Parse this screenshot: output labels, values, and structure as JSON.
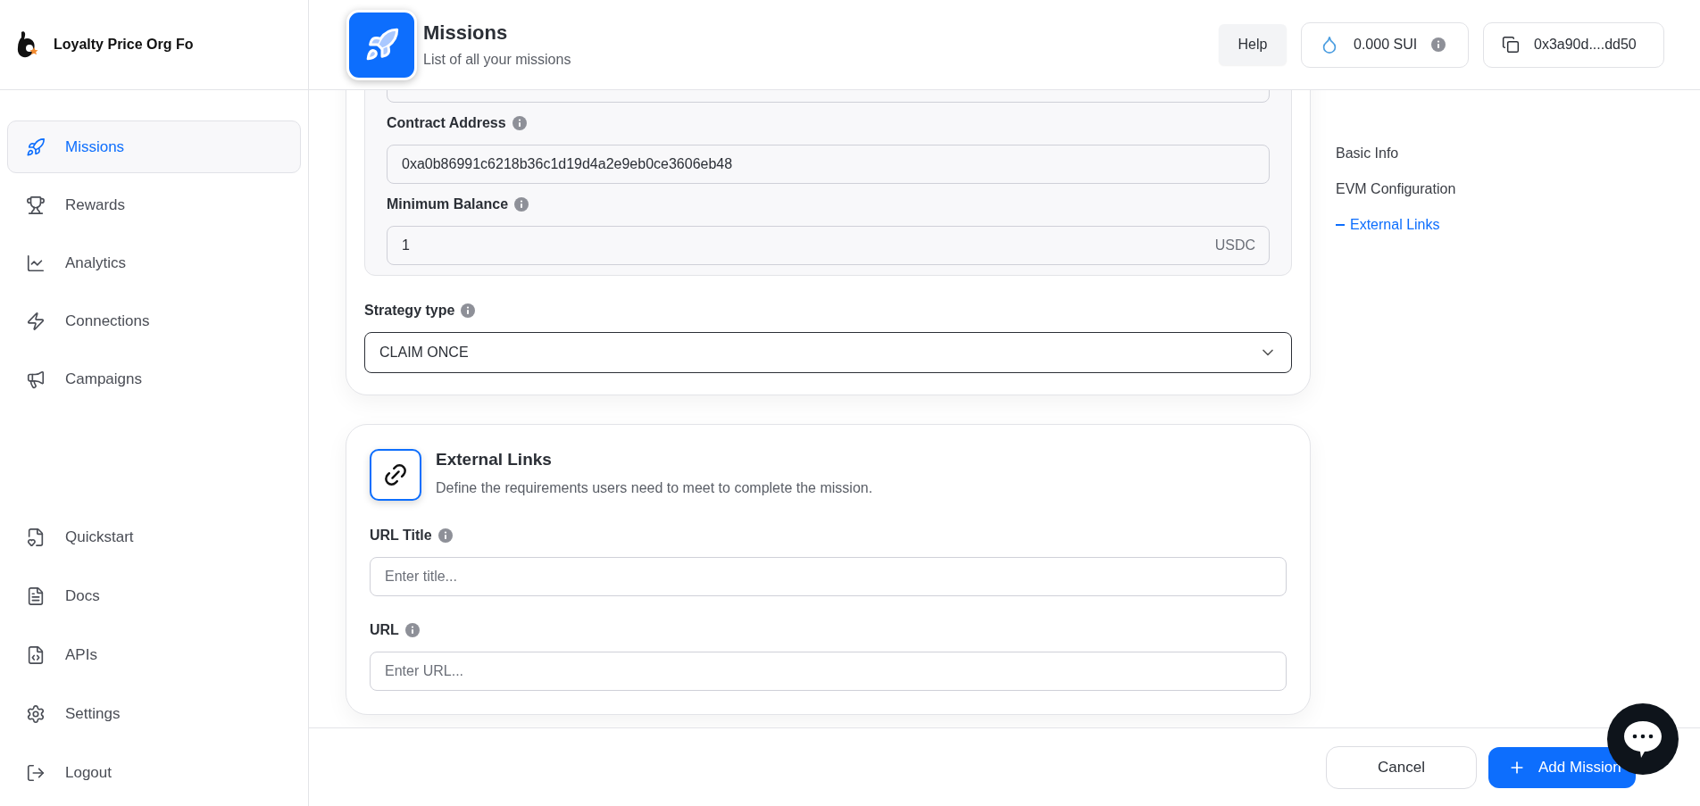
{
  "brand": {
    "name": "Loyalty Price Org Fo"
  },
  "sidebar": {
    "items": [
      {
        "label": "Missions",
        "selected": true
      },
      {
        "label": "Rewards",
        "selected": false
      },
      {
        "label": "Analytics",
        "selected": false
      },
      {
        "label": "Connections",
        "selected": false
      },
      {
        "label": "Campaigns",
        "selected": false
      }
    ],
    "bottom_items": [
      {
        "label": "Quickstart"
      },
      {
        "label": "Docs"
      },
      {
        "label": "APIs"
      },
      {
        "label": "Settings"
      },
      {
        "label": "Logout"
      }
    ]
  },
  "header": {
    "title": "Missions",
    "subtitle": "List of all your missions",
    "help": "Help",
    "balance": "0.000 SUI",
    "address": "0x3a90d....dd50"
  },
  "evm_card": {
    "fields": [
      {
        "label": "Contract Address",
        "value": "0xa0b86991c6218b36c1d19d4a2e9eb0ce3606eb48"
      },
      {
        "label": "Minimum Balance",
        "value": "1",
        "suffix": "USDC"
      }
    ],
    "strategy": {
      "label": "Strategy type",
      "value": "CLAIM ONCE"
    }
  },
  "links_card": {
    "title": "External Links",
    "description": "Define the requirements users need to meet to complete the mission.",
    "fields": [
      {
        "label": "URL Title",
        "placeholder": "Enter title..."
      },
      {
        "label": "URL",
        "placeholder": "Enter URL..."
      }
    ]
  },
  "section_nav": [
    {
      "label": "Basic Info",
      "selected": false
    },
    {
      "label": "EVM Configuration",
      "selected": false
    },
    {
      "label": "External Links",
      "selected": true
    }
  ],
  "footer": {
    "cancel": "Cancel",
    "submit": "Add Mission"
  }
}
